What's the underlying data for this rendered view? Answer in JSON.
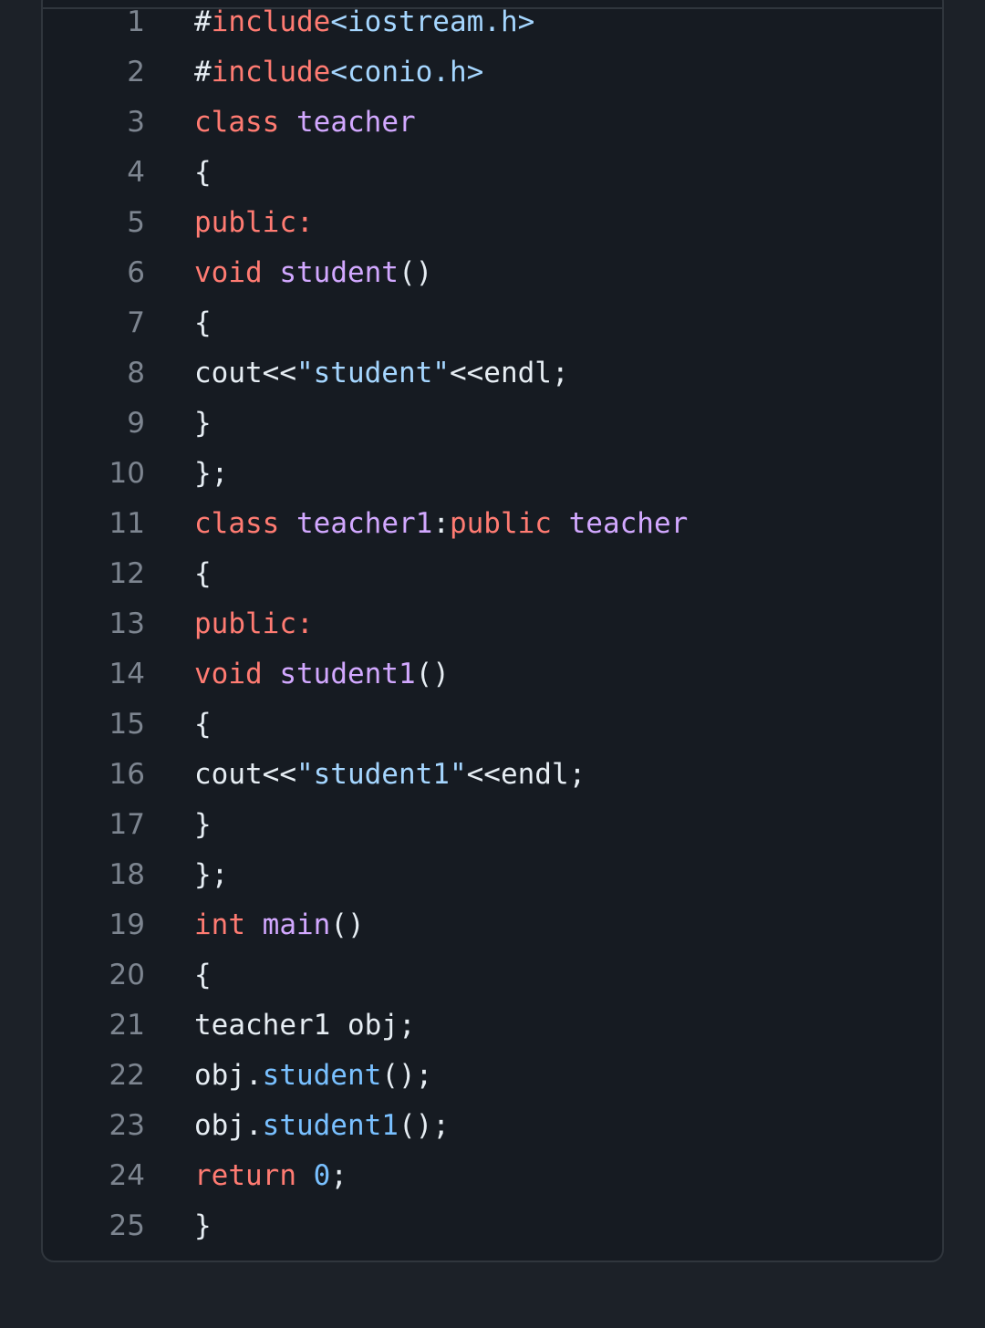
{
  "colors": {
    "background": "#1c2128",
    "panel": "#161b22",
    "border": "#30363d",
    "line_number": "#7d8590",
    "plain": "#e6edf3",
    "keyword": "#ff7b72",
    "entity": "#d2a8ff",
    "string": "#a5d6ff",
    "constant": "#79c0ff"
  },
  "code": {
    "language": "cpp",
    "lines": [
      {
        "n": "1",
        "tokens": [
          {
            "t": "#",
            "c": "plain"
          },
          {
            "t": "include",
            "c": "keyword"
          },
          {
            "t": "<iostream.h>",
            "c": "string"
          }
        ]
      },
      {
        "n": "2",
        "tokens": [
          {
            "t": "#",
            "c": "plain"
          },
          {
            "t": "include",
            "c": "keyword"
          },
          {
            "t": "<conio.h>",
            "c": "string"
          }
        ]
      },
      {
        "n": "3",
        "tokens": [
          {
            "t": "class",
            "c": "keyword"
          },
          {
            "t": " ",
            "c": "plain"
          },
          {
            "t": "teacher",
            "c": "entity"
          }
        ]
      },
      {
        "n": "4",
        "tokens": [
          {
            "t": "{",
            "c": "plain"
          }
        ]
      },
      {
        "n": "5",
        "tokens": [
          {
            "t": "public:",
            "c": "keyword"
          }
        ]
      },
      {
        "n": "6",
        "tokens": [
          {
            "t": "void",
            "c": "keyword"
          },
          {
            "t": " ",
            "c": "plain"
          },
          {
            "t": "student",
            "c": "entity"
          },
          {
            "t": "()",
            "c": "plain"
          }
        ]
      },
      {
        "n": "7",
        "tokens": [
          {
            "t": "{",
            "c": "plain"
          }
        ]
      },
      {
        "n": "8",
        "tokens": [
          {
            "t": "cout<<",
            "c": "plain"
          },
          {
            "t": "\"student\"",
            "c": "string"
          },
          {
            "t": "<<endl;",
            "c": "plain"
          }
        ]
      },
      {
        "n": "9",
        "tokens": [
          {
            "t": "}",
            "c": "plain"
          }
        ]
      },
      {
        "n": "10",
        "tokens": [
          {
            "t": "};",
            "c": "plain"
          }
        ]
      },
      {
        "n": "11",
        "tokens": [
          {
            "t": "class",
            "c": "keyword"
          },
          {
            "t": " ",
            "c": "plain"
          },
          {
            "t": "teacher1",
            "c": "entity"
          },
          {
            "t": ":",
            "c": "plain"
          },
          {
            "t": "public",
            "c": "keyword"
          },
          {
            "t": " ",
            "c": "plain"
          },
          {
            "t": "teacher",
            "c": "entity"
          }
        ]
      },
      {
        "n": "12",
        "tokens": [
          {
            "t": "{",
            "c": "plain"
          }
        ]
      },
      {
        "n": "13",
        "tokens": [
          {
            "t": "public:",
            "c": "keyword"
          }
        ]
      },
      {
        "n": "14",
        "tokens": [
          {
            "t": "void",
            "c": "keyword"
          },
          {
            "t": " ",
            "c": "plain"
          },
          {
            "t": "student1",
            "c": "entity"
          },
          {
            "t": "()",
            "c": "plain"
          }
        ]
      },
      {
        "n": "15",
        "tokens": [
          {
            "t": "{",
            "c": "plain"
          }
        ]
      },
      {
        "n": "16",
        "tokens": [
          {
            "t": "cout<<",
            "c": "plain"
          },
          {
            "t": "\"student1\"",
            "c": "string"
          },
          {
            "t": "<<endl;",
            "c": "plain"
          }
        ]
      },
      {
        "n": "17",
        "tokens": [
          {
            "t": "}",
            "c": "plain"
          }
        ]
      },
      {
        "n": "18",
        "tokens": [
          {
            "t": "};",
            "c": "plain"
          }
        ]
      },
      {
        "n": "19",
        "tokens": [
          {
            "t": "int",
            "c": "keyword"
          },
          {
            "t": " ",
            "c": "plain"
          },
          {
            "t": "main",
            "c": "entity"
          },
          {
            "t": "()",
            "c": "plain"
          }
        ]
      },
      {
        "n": "20",
        "tokens": [
          {
            "t": "{",
            "c": "plain"
          }
        ]
      },
      {
        "n": "21",
        "tokens": [
          {
            "t": "teacher1 obj;",
            "c": "plain"
          }
        ]
      },
      {
        "n": "22",
        "tokens": [
          {
            "t": "obj.",
            "c": "plain"
          },
          {
            "t": "student",
            "c": "constant"
          },
          {
            "t": "();",
            "c": "plain"
          }
        ]
      },
      {
        "n": "23",
        "tokens": [
          {
            "t": "obj.",
            "c": "plain"
          },
          {
            "t": "student1",
            "c": "constant"
          },
          {
            "t": "();",
            "c": "plain"
          }
        ]
      },
      {
        "n": "24",
        "tokens": [
          {
            "t": "return",
            "c": "keyword"
          },
          {
            "t": " ",
            "c": "plain"
          },
          {
            "t": "0",
            "c": "constant"
          },
          {
            "t": ";",
            "c": "plain"
          }
        ]
      },
      {
        "n": "25",
        "tokens": [
          {
            "t": "}",
            "c": "plain"
          }
        ]
      }
    ]
  }
}
